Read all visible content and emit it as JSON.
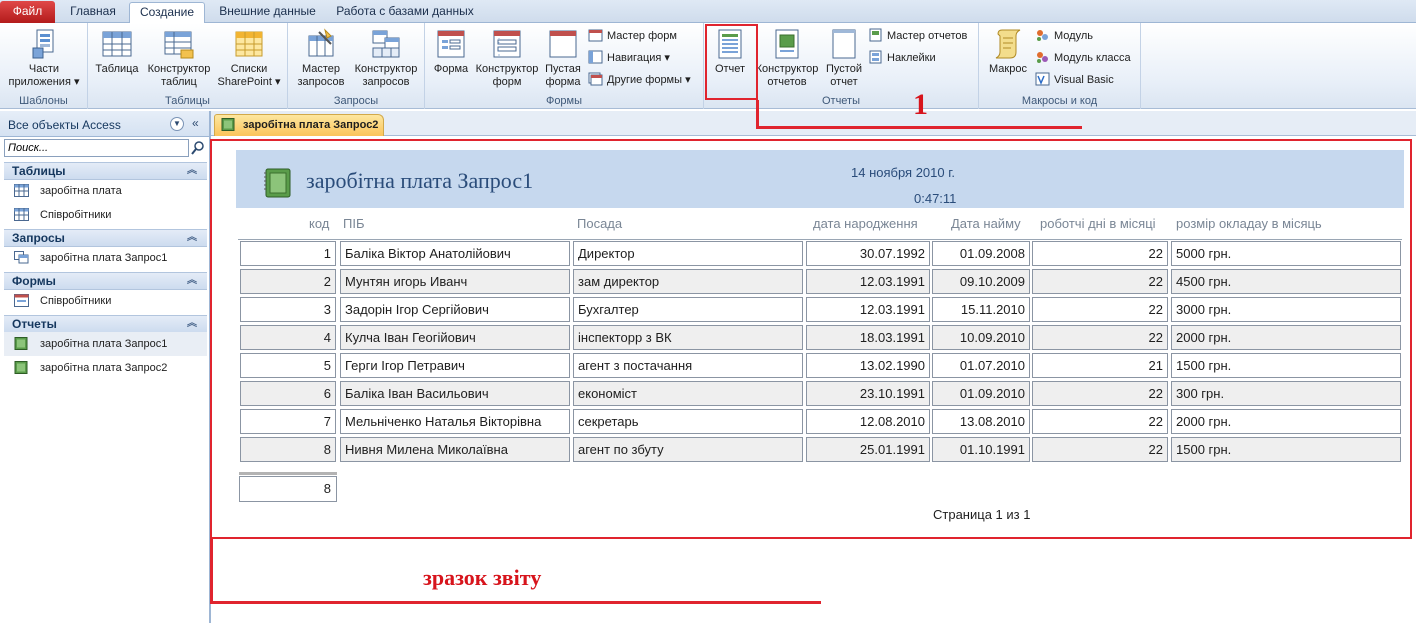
{
  "tabs": {
    "file": "Файл",
    "home": "Главная",
    "create": "Создание",
    "external": "Внешние данные",
    "database": "Работа с базами данных"
  },
  "ribbon": {
    "groups": {
      "templates": "Шаблоны",
      "tables": "Таблицы",
      "queries": "Запросы",
      "forms": "Формы",
      "reports": "Отчеты",
      "macros": "Макросы и код"
    },
    "app_parts": [
      "Части",
      "приложения ▾"
    ],
    "table": "Таблица",
    "table_designer": [
      "Конструктор",
      "таблиц"
    ],
    "sharepoint": [
      "Списки",
      "SharePoint ▾"
    ],
    "query_wizard": [
      "Мастер",
      "запросов"
    ],
    "query_designer": [
      "Конструктор",
      "запросов"
    ],
    "form": "Форма",
    "form_designer": [
      "Конструктор",
      "форм"
    ],
    "blank_form": [
      "Пустая",
      "форма"
    ],
    "form_wizard": "Мастер форм",
    "navigation": "Навигация ▾",
    "more_forms": "Другие формы ▾",
    "report": "Отчет",
    "report_designer": [
      "Конструктор",
      "отчетов"
    ],
    "blank_report": [
      "Пустой",
      "отчет"
    ],
    "report_wizard": "Мастер отчетов",
    "labels": "Наклейки",
    "macro": "Макрос",
    "module": "Модуль",
    "class_module": "Модуль класса",
    "vba": "Visual Basic"
  },
  "annotations": {
    "one": "1",
    "sample": "зразок звіту"
  },
  "nav": {
    "title": "Все объекты Access",
    "search_placeholder": "Поиск...",
    "sections": [
      {
        "label": "Таблицы",
        "items": [
          "заробітна плата",
          "Співробітники"
        ]
      },
      {
        "label": "Запросы",
        "items": [
          "заробітна плата Запрос1"
        ]
      },
      {
        "label": "Формы",
        "items": [
          "Співробітники"
        ]
      },
      {
        "label": "Отчеты",
        "items": [
          "заробітна плата Запрос1",
          "заробітна плата Запрос2"
        ]
      }
    ]
  },
  "doc_tab": "заробітна плата Запрос2",
  "report": {
    "title": "заробітна плата Запрос1",
    "date": "14 ноября 2010 г.",
    "time": "0:47:11",
    "columns": [
      "код",
      "ПІБ",
      "Посада",
      "дата народження",
      "Дата найму",
      "роботчі дні в місяці",
      "розмір окладау в місяць"
    ],
    "rows": [
      [
        "1",
        "Баліка Віктор Анатолійович",
        "Директор",
        "30.07.1992",
        "01.09.2008",
        "22",
        "5000 грн."
      ],
      [
        "2",
        "Мунтян игорь Иванч",
        "зам директор",
        "12.03.1991",
        "09.10.2009",
        "22",
        "4500 грн."
      ],
      [
        "3",
        "Задорін Ігор Сергійович",
        "Бухгалтер",
        "12.03.1991",
        "15.11.2010",
        "22",
        "3000 грн."
      ],
      [
        "4",
        "Кулча Іван Геогійович",
        "інспекторр з ВК",
        "18.03.1991",
        "10.09.2010",
        "22",
        "2000 грн."
      ],
      [
        "5",
        "Герги Ігор Петравич",
        "агент з постачання",
        "13.02.1990",
        "01.07.2010",
        "21",
        "1500 грн."
      ],
      [
        "6",
        "Баліка Іван Васильович",
        "економіст",
        "23.10.1991",
        "01.09.2010",
        "22",
        "300 грн."
      ],
      [
        "7",
        "Мельніченко Наталья Вікторівна",
        "секретарь",
        "12.08.2010",
        "13.08.2010",
        "22",
        "2000 грн."
      ],
      [
        "8",
        "Нивня Милена Миколаївна",
        "агент по збуту",
        "25.01.1991",
        "01.10.1991",
        "22",
        "1500 грн."
      ]
    ],
    "count": "8",
    "page_info": "Страница 1 из 1"
  }
}
